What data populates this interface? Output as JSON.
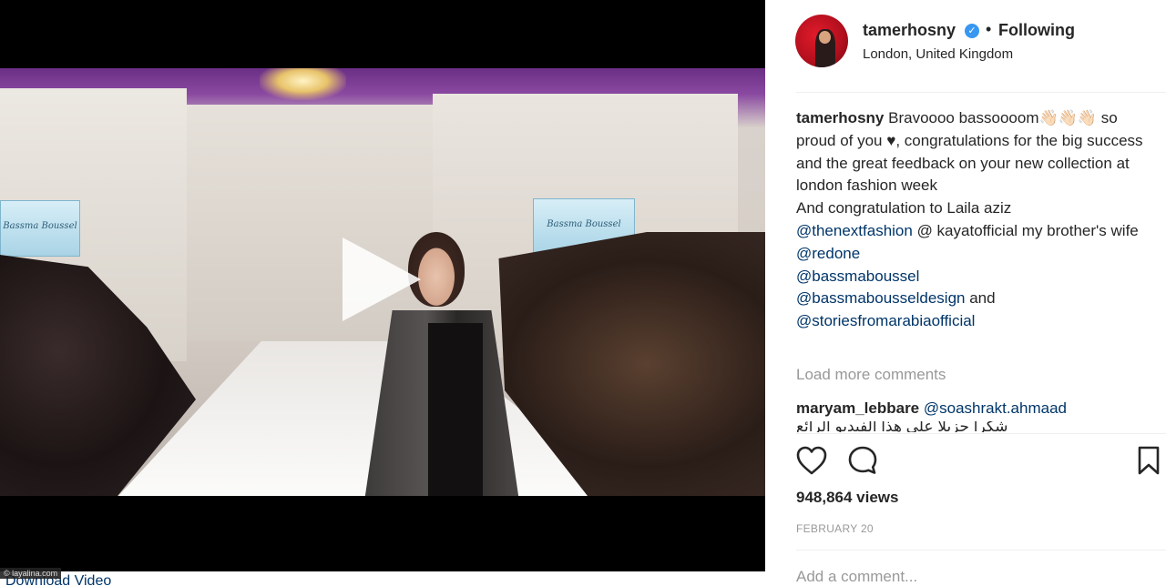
{
  "video": {
    "screen_text_left": "Bassma Boussel",
    "screen_text_right": "Bassma Boussel",
    "download_label": "Download Video",
    "watermark": "© layalina.com"
  },
  "post": {
    "username": "tamerhosny",
    "separator_dot": "•",
    "following_label": "Following",
    "location": "London, United Kingdom",
    "caption": {
      "username": "tamerhosny",
      "text_1": "Bravoooo bassoooom👋🏻👋🏻👋🏻",
      "text_2": "so proud of you ♥, congratulations for the big success and the great feedback on your new collection at london fashion week",
      "text_3": "And congratulation to Laila aziz",
      "mention_1": "@thenextfashion",
      "text_4": "@ kayatofficial my brother's wife",
      "mention_2": "@redone",
      "mention_3": "@bassmaboussel",
      "mention_4": "@bassmabousseldesign",
      "text_5": "and",
      "mention_5": "@storiesfromarabiaofficial"
    },
    "load_more_label": "Load more comments",
    "comment": {
      "username": "maryam_lebbare",
      "mention": "@soashrakt.ahmaad",
      "partial_text": "شكرا جزيلا على هذا الفيديو الرائع"
    },
    "views": "948,864 views",
    "date": "FEBRUARY 20",
    "add_comment_placeholder": "Add a comment..."
  },
  "colors": {
    "link": "#003569",
    "muted": "#999999",
    "verified": "#3897f0",
    "text": "#262626"
  },
  "icons": [
    "heart-icon",
    "comment-icon",
    "bookmark-icon",
    "play-icon",
    "verified-icon"
  ]
}
